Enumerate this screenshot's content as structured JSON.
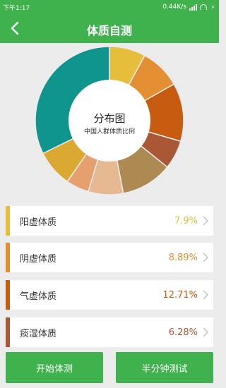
{
  "status_bar": {
    "time": "下午1:17",
    "network_speed": "0.44K/s",
    "icons": [
      "signal-icon",
      "wifi-icon",
      "battery-icon"
    ]
  },
  "header": {
    "title": "体质自测",
    "back_icon": "chevron-left-icon"
  },
  "chart_data": {
    "type": "pie",
    "title": "分布图",
    "subtitle": "中国人群体质比例",
    "slices": [
      {
        "name": "阳虚体质",
        "value": 7.9,
        "color": "#e6be3b"
      },
      {
        "name": "阴虚体质",
        "value": 8.89,
        "color": "#e48f34"
      },
      {
        "name": "气虚体质",
        "value": 12.71,
        "color": "#c75c11"
      },
      {
        "name": "痰湿体质",
        "value": 6.28,
        "color": "#a95735"
      },
      {
        "value": 11.23,
        "color": "#ac8a52"
      },
      {
        "value": 7.62,
        "color": "#e7b993"
      },
      {
        "value": 5.0,
        "color": "#e5a06d"
      },
      {
        "value": 8.07,
        "color": "#dba931"
      },
      {
        "value": 32.3,
        "color": "#0f958d"
      }
    ]
  },
  "list": {
    "items": [
      {
        "label": "阳虚体质",
        "value": "7.9%",
        "color": "#e6be3b"
      },
      {
        "label": "阴虚体质",
        "value": "8.89%",
        "color": "#e48f34"
      },
      {
        "label": "气虚体质",
        "value": "12.71%",
        "color": "#c75c11"
      },
      {
        "label": "痰湿体质",
        "value": "6.28%",
        "color": "#a95735"
      }
    ]
  },
  "actions": {
    "start_test": "开始体测",
    "half_minute_test": "半分钟测试"
  },
  "colors": {
    "brand_green": "#3fb24d",
    "background": "#ececec",
    "chevron": "#bdbdbd"
  }
}
